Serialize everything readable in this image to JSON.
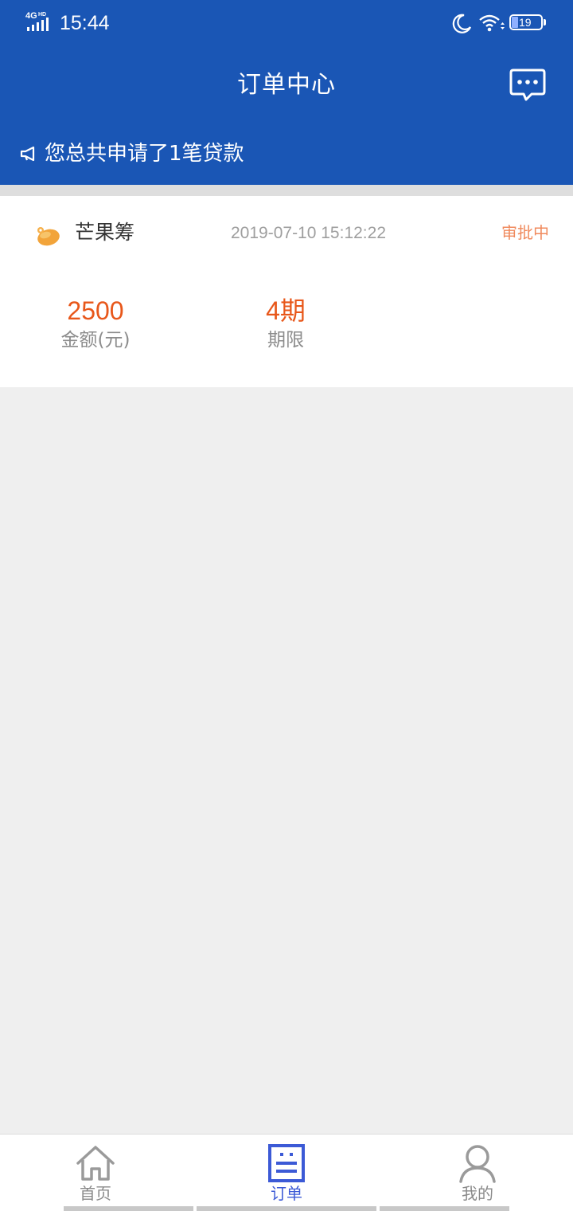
{
  "status_bar": {
    "network": "4G HD",
    "time": "15:44",
    "battery": "19"
  },
  "header": {
    "title": "订单中心",
    "message_icon": "chat-bubble-icon",
    "notice": "您总共申请了1笔贷款",
    "notice_icon": "megaphone-icon"
  },
  "order": {
    "brand_icon": "mango-logo-icon",
    "brand_name": "芒果筹",
    "time": "2019-07-10 15:12:22",
    "status": "审批中",
    "amount_value": "2500",
    "amount_label": "金额(元)",
    "term_value": "4期",
    "term_label": "期限"
  },
  "tabs": [
    {
      "label": "首页",
      "icon": "home-icon",
      "active": false
    },
    {
      "label": "订单",
      "icon": "order-list-icon",
      "active": true
    },
    {
      "label": "我的",
      "icon": "user-icon",
      "active": false
    }
  ],
  "colors": {
    "primary": "#1a56b5",
    "accent_orange": "#e8571a",
    "status_orange": "#f08a5d",
    "tab_active": "#3c5ad6"
  }
}
